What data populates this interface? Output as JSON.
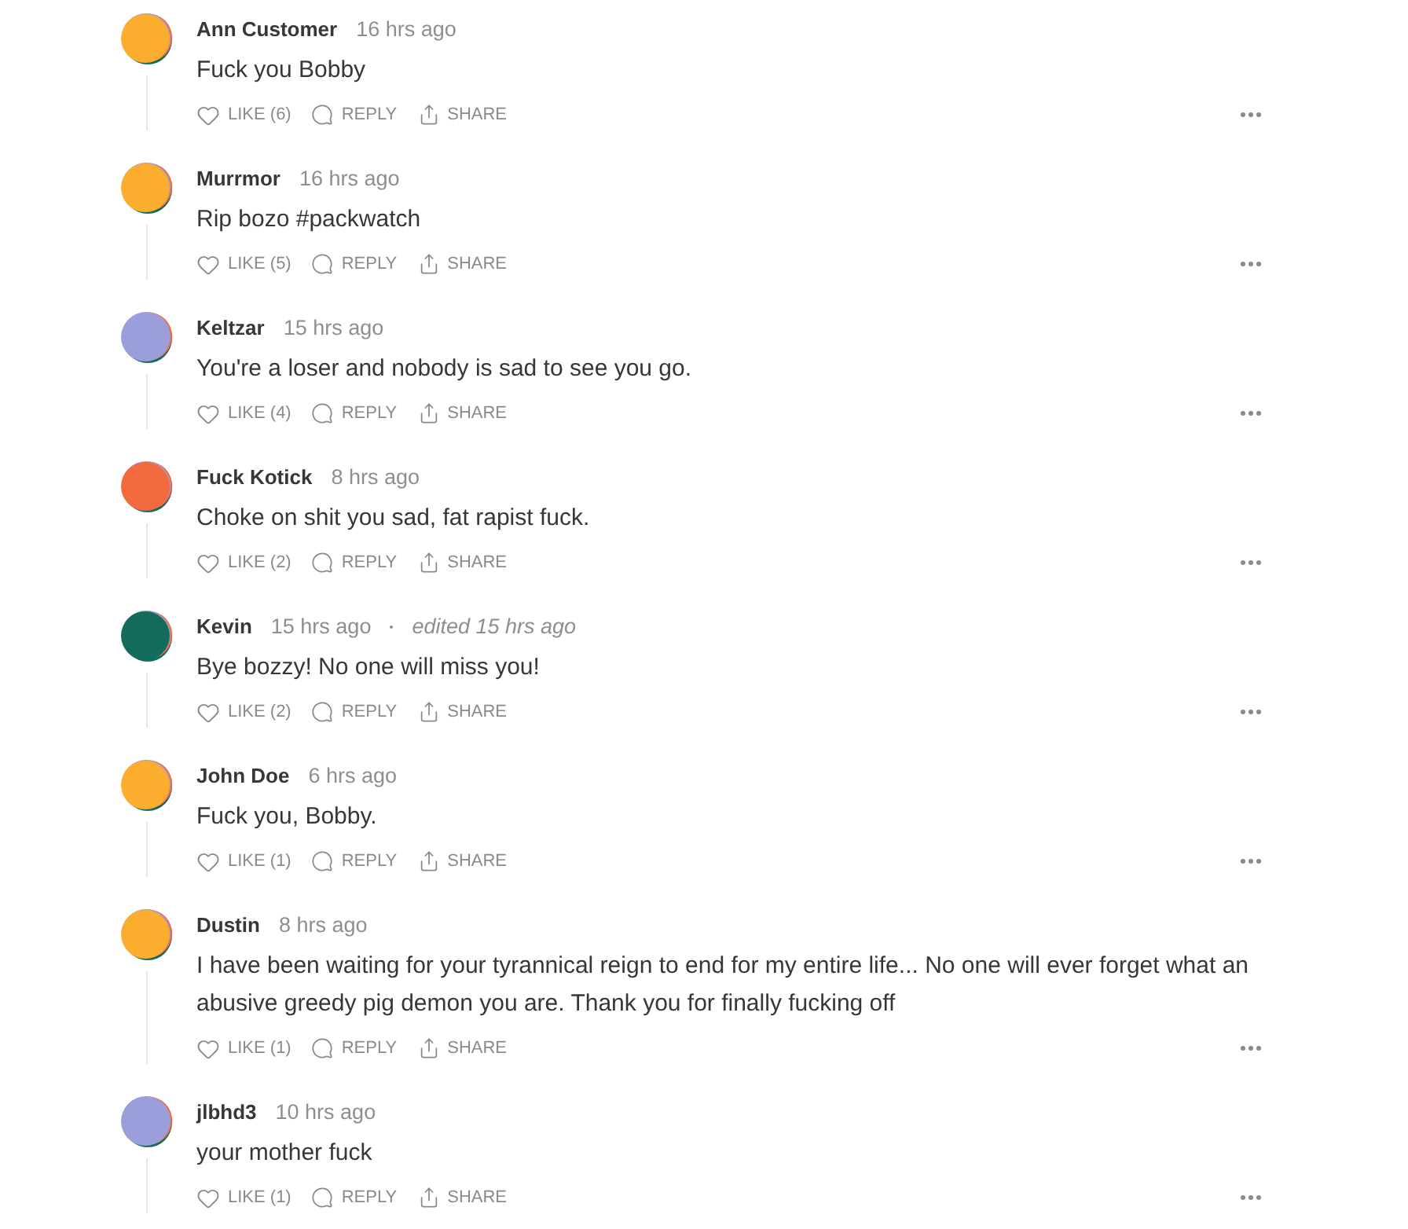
{
  "comments": [
    {
      "author": "Ann Customer",
      "time": "16 hrs ago",
      "text": "Fuck you Bobby",
      "color": "#fbad2e",
      "like": "LIKE (6)",
      "reply": "REPLY",
      "share": "SHARE"
    },
    {
      "author": "Murrmor",
      "time": "16 hrs ago",
      "text": "Rip bozo #packwatch",
      "color": "#fbad2e",
      "like": "LIKE (5)",
      "reply": "REPLY",
      "share": "SHARE"
    },
    {
      "author": "Keltzar",
      "time": "15 hrs ago",
      "text": "You're a loser and nobody is sad to see you go.",
      "color": "#9a9fdb",
      "like": "LIKE (4)",
      "reply": "REPLY",
      "share": "SHARE"
    },
    {
      "author": "Fuck Kotick",
      "time": "8 hrs ago",
      "text": "Choke on shit you sad, fat rapist fuck.",
      "color": "#f36a3e",
      "like": "LIKE (2)",
      "reply": "REPLY",
      "share": "SHARE"
    },
    {
      "author": "Kevin",
      "time": "15 hrs ago",
      "edited": "edited 15 hrs ago",
      "text": "Bye bozzy! No one will miss you!",
      "color": "#136b5b",
      "like": "LIKE (2)",
      "reply": "REPLY",
      "share": "SHARE"
    },
    {
      "author": "John Doe",
      "time": "6 hrs ago",
      "text": "Fuck you, Bobby.",
      "color": "#fbad2e",
      "like": "LIKE (1)",
      "reply": "REPLY",
      "share": "SHARE"
    },
    {
      "author": "Dustin",
      "time": "8 hrs ago",
      "text": "I have been waiting for your tyrannical reign to end for my entire life... No one will ever forget what an abusive greedy pig demon you are. Thank you for finally fucking off",
      "color": "#fbad2e",
      "like": "LIKE (1)",
      "reply": "REPLY",
      "share": "SHARE"
    },
    {
      "author": "jlbhd3",
      "time": "10 hrs ago",
      "text": "your mother fuck",
      "color": "#9a9fdb",
      "like": "LIKE (1)",
      "reply": "REPLY",
      "share": "SHARE"
    }
  ]
}
